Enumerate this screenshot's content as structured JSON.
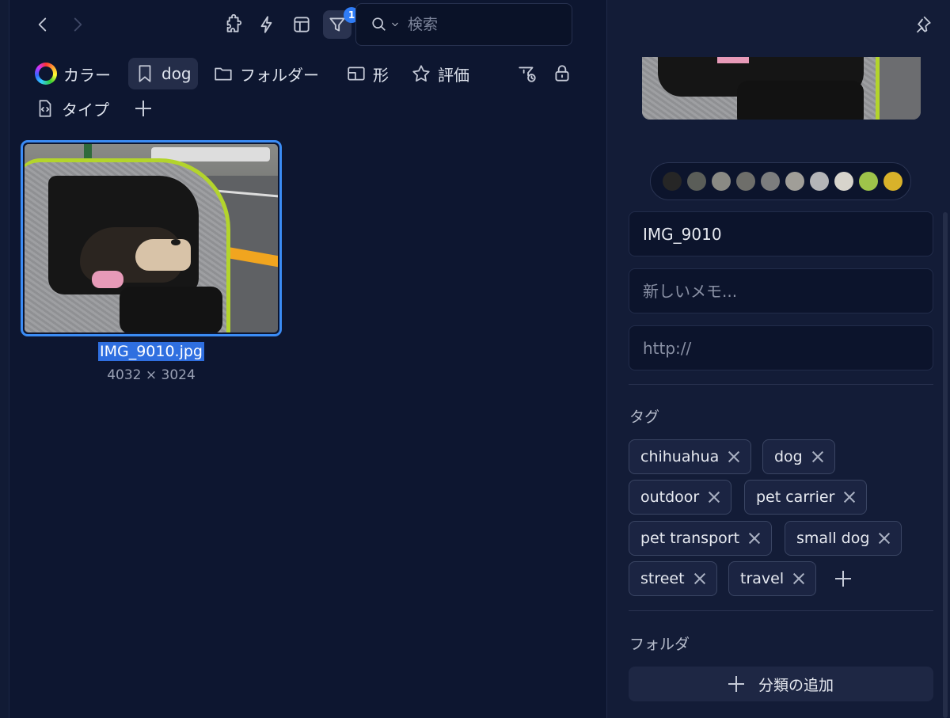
{
  "toolbar": {
    "search_placeholder": "検索",
    "filter_badge": "1",
    "icons": [
      "chevron-left-icon",
      "chevron-right-icon",
      "puzzle-icon",
      "lightning-icon",
      "layout-icon",
      "filter-icon",
      "search-icon"
    ]
  },
  "filters": {
    "color_label": "カラー",
    "tag_label": "dog",
    "folder_label": "フォルダー",
    "shape_label": "形",
    "rating_label": "評価",
    "type_label": "タイプ"
  },
  "item": {
    "filename": "IMG_9010.jpg",
    "dimensions": "4032 × 3024"
  },
  "inspector": {
    "palette": [
      "#262626",
      "#5a5d58",
      "#8a8a84",
      "#6e6e6a",
      "#7c7d7e",
      "#a09e98",
      "#b4b5b8",
      "#d7d4cc",
      "#9ec34a",
      "#d9b22a"
    ],
    "name_value": "IMG_9010",
    "memo_placeholder": "新しいメモ...",
    "url_placeholder": "http://",
    "tags_title": "タグ",
    "tags": [
      "chihuahua",
      "dog",
      "outdoor",
      "pet carrier",
      "pet transport",
      "small dog",
      "street",
      "travel"
    ],
    "folder_title": "フォルダ",
    "add_category_label": "分類の追加"
  }
}
